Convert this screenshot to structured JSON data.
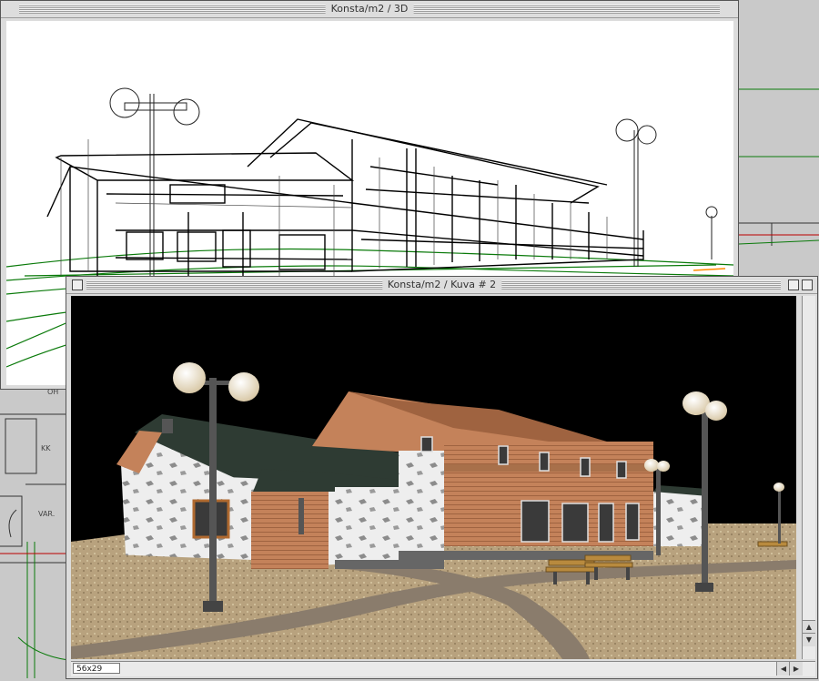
{
  "floorplan": {
    "labels": [
      "OH",
      "KK",
      "VAR."
    ]
  },
  "window_3d": {
    "title": "Konsta/m2 / 3D"
  },
  "window_render": {
    "title": "Konsta/m2 / Kuva # 2",
    "status": "56x29",
    "scroll_up": "▲",
    "scroll_down": "▼",
    "scroll_left": "◀",
    "scroll_right": "▶"
  },
  "colors": {
    "desktop": "#c9c9c9",
    "wire_black": "#000000",
    "wire_green": "#0a7a0a",
    "wire_orange": "#ff8a00",
    "sky": "#000000",
    "ground": "#b8a27e",
    "path": "#8a7c6c",
    "wood": "#c4825a",
    "roof": "#2e3b33"
  }
}
